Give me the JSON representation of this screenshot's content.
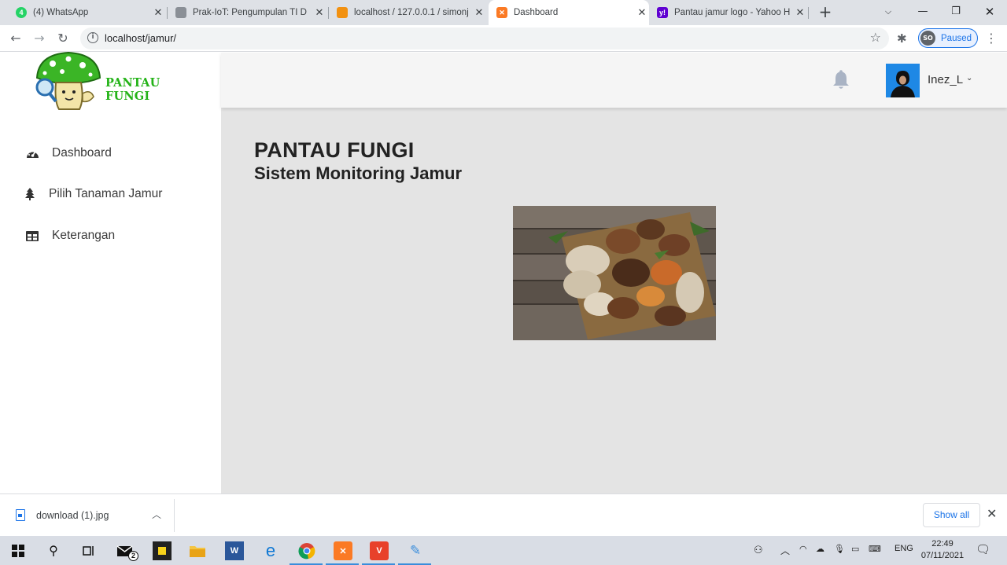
{
  "browser": {
    "tabs": [
      {
        "title": "(4) WhatsApp",
        "icon": "whatsapp-icon"
      },
      {
        "title": "Prak-IoT: Pengumpulan TI D",
        "icon": "document-icon"
      },
      {
        "title": "localhost / 127.0.0.1 / simonj",
        "icon": "phpmyadmin-icon"
      },
      {
        "title": "Dashboard",
        "icon": "xampp-icon"
      },
      {
        "title": "Pantau jamur logo - Yahoo H",
        "icon": "yahoo-icon"
      }
    ],
    "active_tab": 3,
    "url": "localhost/jamur/",
    "profile": {
      "initials": "SO",
      "status": "Paused"
    }
  },
  "app": {
    "brand_name": "PANTAU FUNGI",
    "sidebar": {
      "items": [
        {
          "label": "Dashboard",
          "icon": "tachometer-icon"
        },
        {
          "label": "Pilih Tanaman Jamur",
          "icon": "tree-icon"
        },
        {
          "label": "Keterangan",
          "icon": "table-icon"
        }
      ]
    },
    "topbar": {
      "user_name": "Inez_L"
    },
    "main": {
      "title": "PANTAU FUNGI",
      "subtitle": "Sistem Monitoring Jamur"
    }
  },
  "downloads": {
    "file_name": "download (1).jpg",
    "show_all_label": "Show all"
  },
  "taskbar": {
    "language": "ENG",
    "time": "22:49",
    "date": "07/11/2021",
    "mail_badge": "2"
  },
  "colors": {
    "brand_green": "#24b318",
    "page_bg": "#e4e4e4",
    "accent_blue": "#1a73e8"
  }
}
